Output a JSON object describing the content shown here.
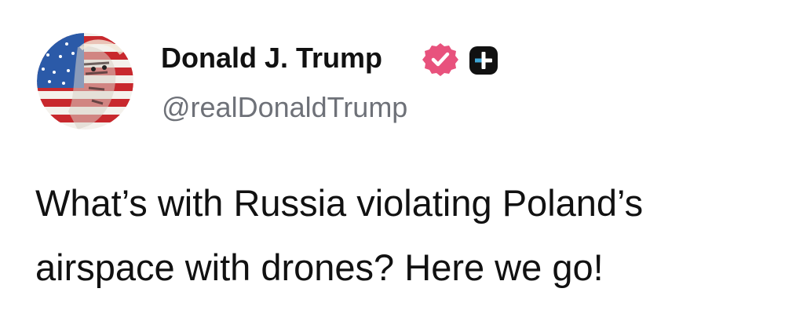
{
  "post": {
    "author": {
      "display_name": "Donald J. Trump",
      "handle": "@realDonaldTrump",
      "avatar_icon": "flag-portrait-avatar",
      "verified_icon": "verified-badge-icon",
      "plus_icon": "subscription-plus-icon"
    },
    "text": "What’s with Russia violating Poland’s airspace with drones? Here we go!"
  },
  "colors": {
    "text_primary": "#111111",
    "text_secondary": "#6e7178",
    "verified_badge": "#e8527d",
    "plus_badge": "#111111",
    "flag_red": "#c8282d",
    "flag_blue": "#2b5aa8",
    "background": "#ffffff"
  }
}
